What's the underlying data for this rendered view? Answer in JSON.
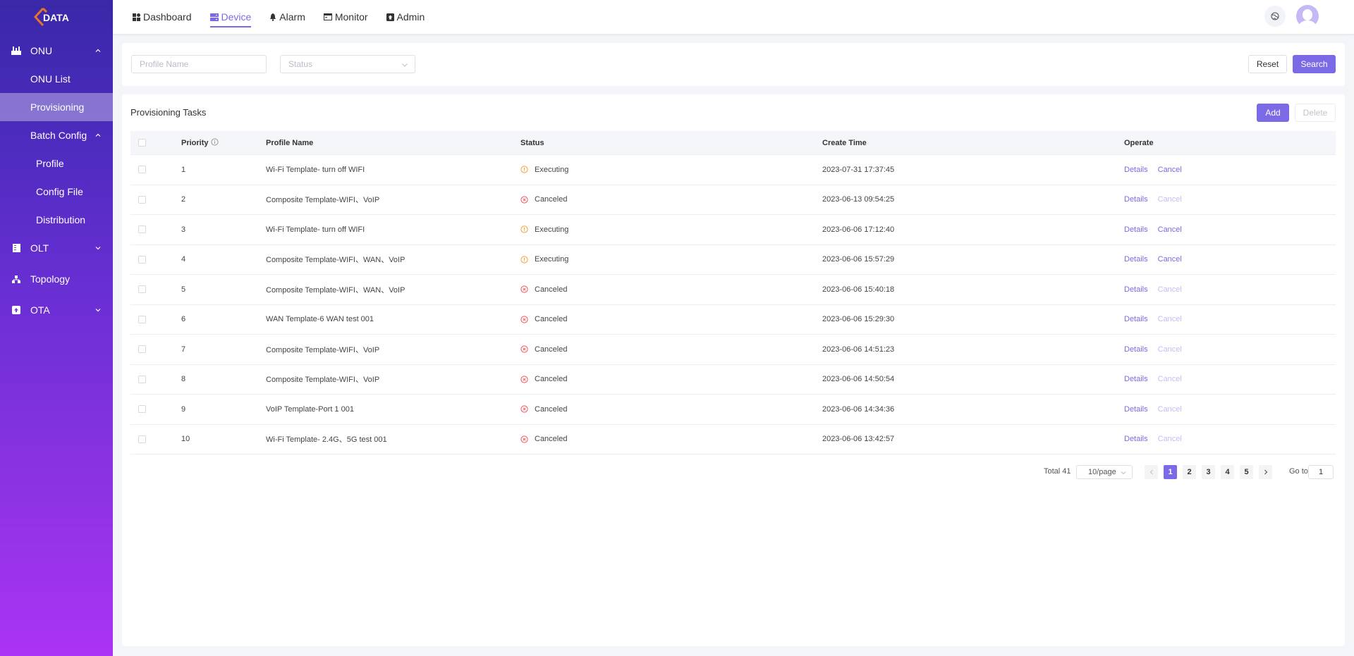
{
  "brand": {
    "logo_text": "DATA",
    "accent": "#7b6ae6",
    "logo_accent": "#e8742a"
  },
  "sidebar": {
    "items": [
      {
        "label": "ONU",
        "icon": "router-icon",
        "expanded": true,
        "children": [
          {
            "label": "ONU List"
          },
          {
            "label": "Provisioning",
            "active": true
          },
          {
            "label": "Batch Config",
            "expanded": true,
            "children": [
              {
                "label": "Profile"
              },
              {
                "label": "Config File"
              },
              {
                "label": "Distribution"
              }
            ]
          }
        ]
      },
      {
        "label": "OLT",
        "icon": "server-list-icon",
        "expanded": false
      },
      {
        "label": "Topology",
        "icon": "topology-icon"
      },
      {
        "label": "OTA",
        "icon": "upload-icon",
        "expanded": false
      }
    ]
  },
  "topnav": {
    "items": [
      {
        "label": "Dashboard",
        "icon": "dashboard-icon"
      },
      {
        "label": "Device",
        "icon": "device-icon",
        "active": true
      },
      {
        "label": "Alarm",
        "icon": "bell-icon"
      },
      {
        "label": "Monitor",
        "icon": "monitor-icon"
      },
      {
        "label": "Admin",
        "icon": "admin-icon"
      }
    ]
  },
  "filter": {
    "profile_placeholder": "Profile Name",
    "profile_value": "",
    "status_placeholder": "Status",
    "reset_label": "Reset",
    "search_label": "Search"
  },
  "tasks": {
    "title": "Provisioning Tasks",
    "add_label": "Add",
    "delete_label": "Delete",
    "columns": [
      "Priority",
      "Profile Name",
      "Status",
      "Create Time",
      "Operate"
    ],
    "rows": [
      {
        "priority": "1",
        "name": "Wi-Fi Template- turn off WIFI",
        "status": "Executing",
        "time": "2023-07-31 17:37:45",
        "details": "Details",
        "cancel": "Cancel",
        "cancel_enabled": true
      },
      {
        "priority": "2",
        "name": "Composite Template-WIFI、VoIP",
        "status": "Canceled",
        "time": "2023-06-13 09:54:25",
        "details": "Details",
        "cancel": "Cancel",
        "cancel_enabled": false
      },
      {
        "priority": "3",
        "name": "Wi-Fi Template- turn off WIFI",
        "status": "Executing",
        "time": "2023-06-06 17:12:40",
        "details": "Details",
        "cancel": "Cancel",
        "cancel_enabled": true
      },
      {
        "priority": "4",
        "name": "Composite Template-WIFI、WAN、VoIP",
        "status": "Executing",
        "time": "2023-06-06 15:57:29",
        "details": "Details",
        "cancel": "Cancel",
        "cancel_enabled": true
      },
      {
        "priority": "5",
        "name": "Composite Template-WIFI、WAN、VoIP",
        "status": "Canceled",
        "time": "2023-06-06 15:40:18",
        "details": "Details",
        "cancel": "Cancel",
        "cancel_enabled": false
      },
      {
        "priority": "6",
        "name": "WAN Template-6 WAN test 001",
        "status": "Canceled",
        "time": "2023-06-06 15:29:30",
        "details": "Details",
        "cancel": "Cancel",
        "cancel_enabled": false
      },
      {
        "priority": "7",
        "name": "Composite Template-WIFI、VoIP",
        "status": "Canceled",
        "time": "2023-06-06 14:51:23",
        "details": "Details",
        "cancel": "Cancel",
        "cancel_enabled": false
      },
      {
        "priority": "8",
        "name": "Composite Template-WIFI、VoIP",
        "status": "Canceled",
        "time": "2023-06-06 14:50:54",
        "details": "Details",
        "cancel": "Cancel",
        "cancel_enabled": false
      },
      {
        "priority": "9",
        "name": "VoIP Template-Port 1 001",
        "status": "Canceled",
        "time": "2023-06-06 14:34:36",
        "details": "Details",
        "cancel": "Cancel",
        "cancel_enabled": false
      },
      {
        "priority": "10",
        "name": "Wi-Fi Template- 2.4G、5G test 001",
        "status": "Canceled",
        "time": "2023-06-06 13:42:57",
        "details": "Details",
        "cancel": "Cancel",
        "cancel_enabled": false
      }
    ],
    "status_colors": {
      "Executing": "#f0a033",
      "Canceled": "#f0545c"
    }
  },
  "pagination": {
    "total_label": "Total 41",
    "page_size": "10/page",
    "pages": [
      "1",
      "2",
      "3",
      "4",
      "5"
    ],
    "current_page": "1",
    "goto_label": "Go to",
    "goto_value": "1"
  }
}
